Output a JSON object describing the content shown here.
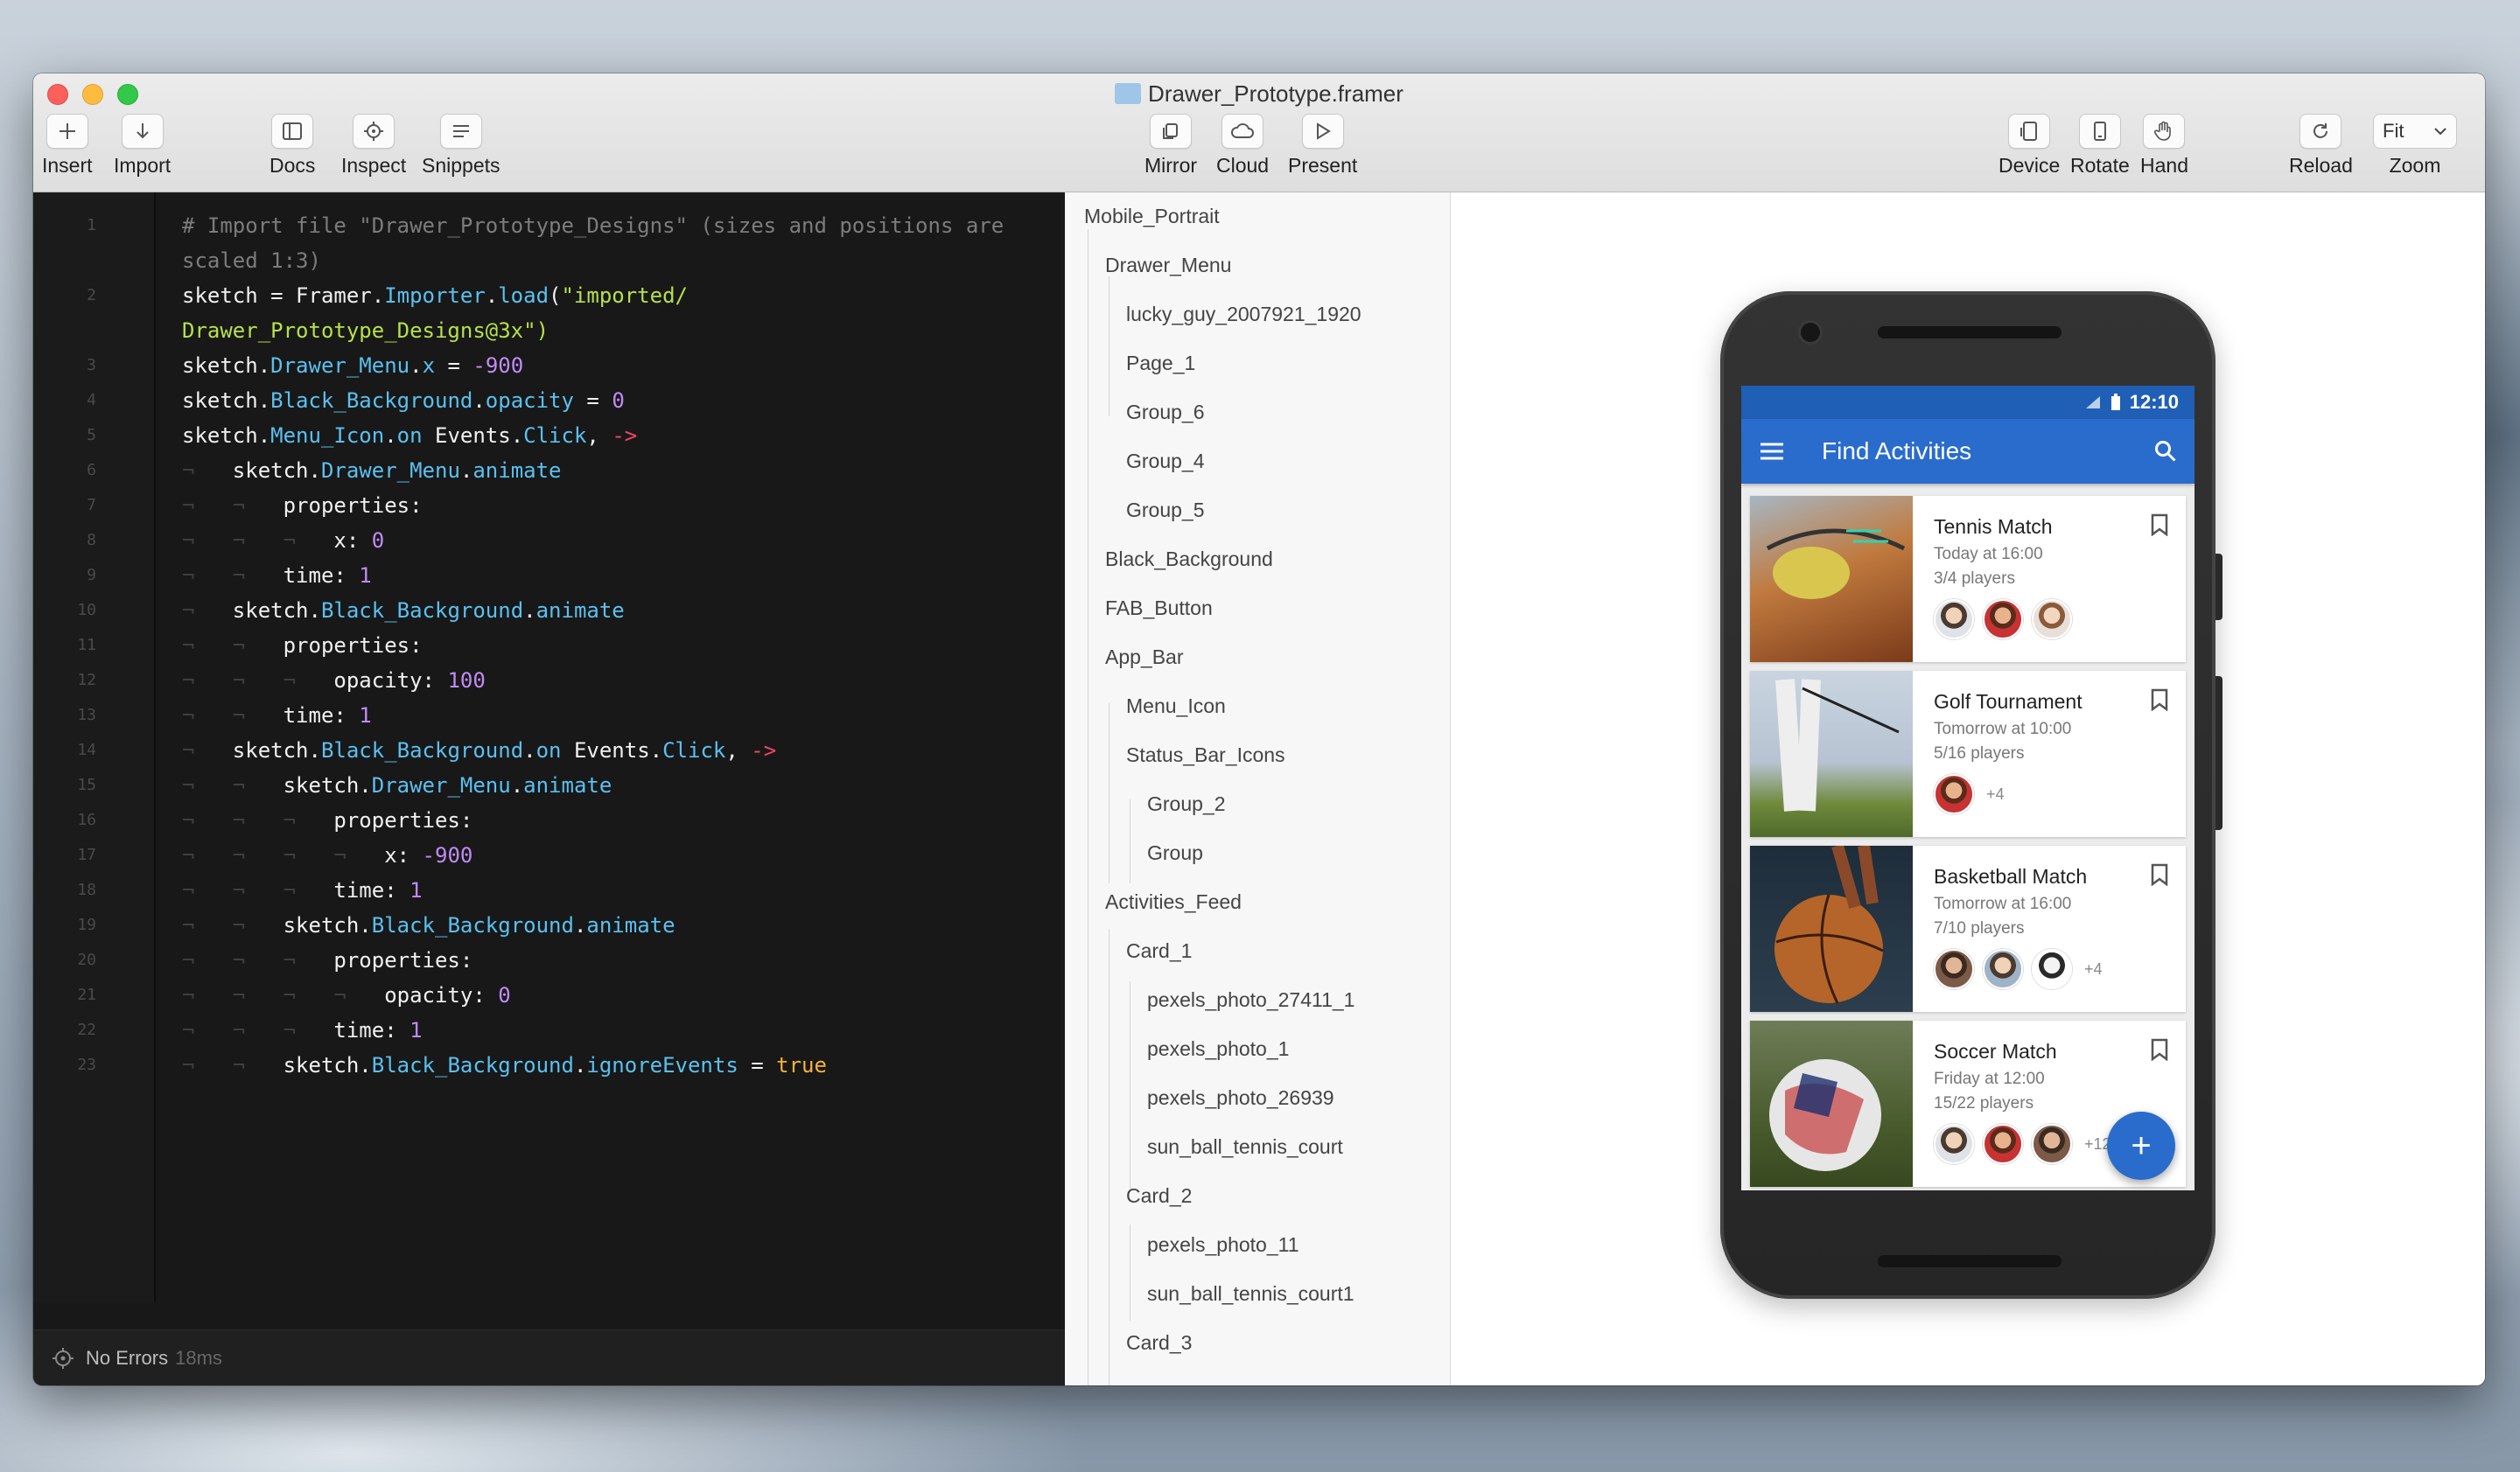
{
  "window": {
    "title": "Drawer_Prototype.framer"
  },
  "toolbar": {
    "left": [
      {
        "label": "Insert",
        "icon": "plus-icon"
      },
      {
        "label": "Import",
        "icon": "arrow-down-icon"
      },
      {
        "label": "Docs",
        "icon": "sidebar-icon"
      },
      {
        "label": "Inspect",
        "icon": "crosshair-icon"
      },
      {
        "label": "Snippets",
        "icon": "lines-icon"
      }
    ],
    "center": [
      {
        "label": "Mirror",
        "icon": "mirror-icon"
      },
      {
        "label": "Cloud",
        "icon": "cloud-icon"
      },
      {
        "label": "Present",
        "icon": "play-icon"
      }
    ],
    "right": [
      {
        "label": "Device",
        "icon": "device-icon"
      },
      {
        "label": "Rotate",
        "icon": "rotate-device-icon"
      },
      {
        "label": "Hand",
        "icon": "hand-icon"
      },
      {
        "label": "Reload",
        "icon": "reload-icon"
      },
      {
        "label": "Zoom",
        "icon": "chevron-down-icon"
      }
    ],
    "zoom_value": "Fit"
  },
  "editor": {
    "status": "No Errors",
    "status_time": "18ms",
    "lines": [
      {
        "n": "1",
        "wrap": "scaled 1:3)"
      },
      {
        "n": "2",
        "wrap": "Drawer_Prototype_Designs@3x\")"
      },
      {
        "n": "3"
      },
      {
        "n": "4"
      },
      {
        "n": "5"
      },
      {
        "n": "6"
      },
      {
        "n": "7"
      },
      {
        "n": "8"
      },
      {
        "n": "9"
      },
      {
        "n": "10"
      },
      {
        "n": "11"
      },
      {
        "n": "12"
      },
      {
        "n": "13"
      },
      {
        "n": "14"
      },
      {
        "n": "15"
      },
      {
        "n": "16"
      },
      {
        "n": "17"
      },
      {
        "n": "18"
      },
      {
        "n": "19"
      },
      {
        "n": "20"
      },
      {
        "n": "21"
      },
      {
        "n": "22"
      },
      {
        "n": "23"
      }
    ]
  },
  "layers": [
    {
      "name": "Mobile_Portrait",
      "depth": 0
    },
    {
      "name": "Drawer_Menu",
      "depth": 1
    },
    {
      "name": "lucky_guy_2007921_1920",
      "depth": 2
    },
    {
      "name": "Page_1",
      "depth": 2
    },
    {
      "name": "Group_6",
      "depth": 2
    },
    {
      "name": "Group_4",
      "depth": 2
    },
    {
      "name": "Group_5",
      "depth": 2
    },
    {
      "name": "Black_Background",
      "depth": 1
    },
    {
      "name": "FAB_Button",
      "depth": 1
    },
    {
      "name": "App_Bar",
      "depth": 1
    },
    {
      "name": "Menu_Icon",
      "depth": 2
    },
    {
      "name": "Status_Bar_Icons",
      "depth": 2
    },
    {
      "name": "Group_2",
      "depth": 3
    },
    {
      "name": "Group",
      "depth": 3
    },
    {
      "name": "Activities_Feed",
      "depth": 1
    },
    {
      "name": "Card_1",
      "depth": 2
    },
    {
      "name": "pexels_photo_27411_1",
      "depth": 3
    },
    {
      "name": "pexels_photo_1",
      "depth": 3
    },
    {
      "name": "pexels_photo_26939",
      "depth": 3
    },
    {
      "name": "sun_ball_tennis_court",
      "depth": 3
    },
    {
      "name": "Card_2",
      "depth": 2
    },
    {
      "name": "pexels_photo_11",
      "depth": 3
    },
    {
      "name": "sun_ball_tennis_court1",
      "depth": 3
    },
    {
      "name": "Card_3",
      "depth": 2
    }
  ],
  "phone": {
    "time": "12:10",
    "app_title": "Find Activities",
    "fab_label": "+",
    "cards": [
      {
        "name": "Tennis Match",
        "when": "Today at 16:00",
        "players": "3/4 players",
        "more": "",
        "avatars": 3,
        "photo": [
          "#c07a3e",
          "#7b3a1a"
        ]
      },
      {
        "name": "Golf Tournament",
        "when": "Tomorrow at 10:00",
        "players": "5/16 players",
        "more": "+4",
        "avatars": 1,
        "photo": [
          "#b9c6d6",
          "#6f8a3c"
        ]
      },
      {
        "name": "Basketball Match",
        "when": "Tomorrow at 16:00",
        "players": "7/10 players",
        "more": "+4",
        "avatars": 3,
        "photo": [
          "#2a3b4a",
          "#b5652a"
        ]
      },
      {
        "name": "Soccer Match",
        "when": "Friday at 12:00",
        "players": "15/22 players",
        "more": "+12",
        "avatars": 3,
        "photo": [
          "#4a5d2e",
          "#d8d8d8"
        ]
      }
    ]
  }
}
